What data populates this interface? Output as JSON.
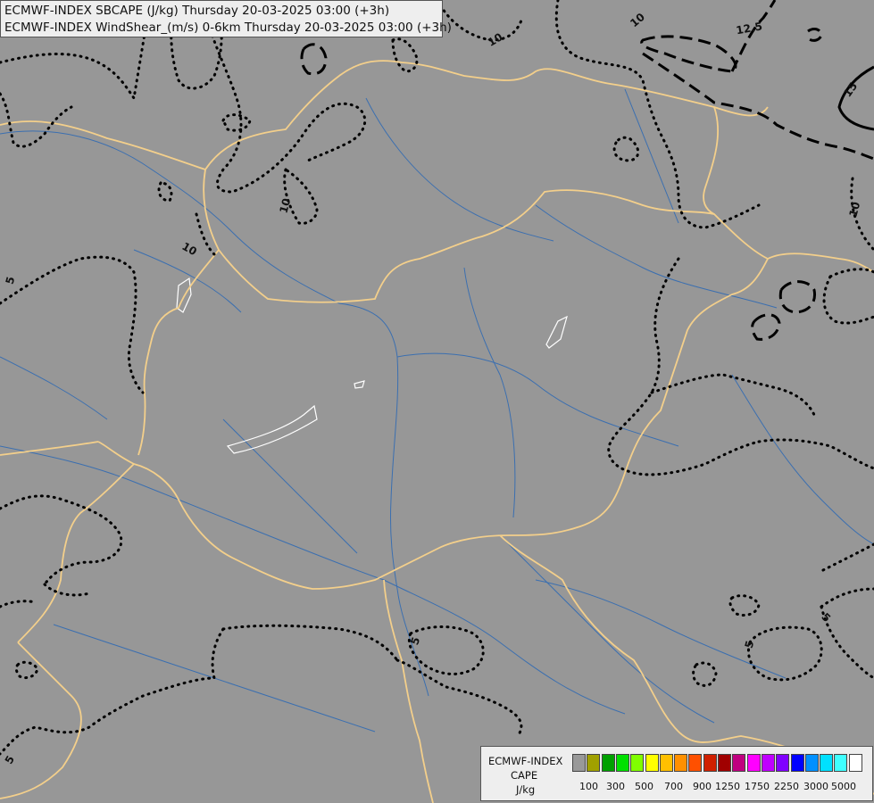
{
  "header": {
    "title_line1": "ECMWF-INDEX SBCAPE (J/kg) Thursday 20-03-2025 03:00 (+3h)",
    "title_line2": "ECMWF-INDEX WindShear_(m/s) 0-6km Thursday 20-03-2025 03:00 (+3h)"
  },
  "legend": {
    "model": "ECMWF-INDEX",
    "variable": "CAPE",
    "unit": "J/kg",
    "colors": [
      "#999999",
      "#a0a000",
      "#00a000",
      "#00e000",
      "#80ff00",
      "#ffff00",
      "#ffc000",
      "#ff9000",
      "#ff5000",
      "#d02000",
      "#a00000",
      "#c00080",
      "#ff00ff",
      "#c000ff",
      "#8000ff",
      "#0000ff",
      "#0090ff",
      "#00e0ff",
      "#40ffff",
      "#ffffff"
    ],
    "ticks": [
      "100",
      "300",
      "500",
      "700",
      "900",
      "1250",
      "1750",
      "2250",
      "3000",
      "5000"
    ]
  },
  "contour_labels": [
    "10",
    "10",
    "10",
    "10",
    "10",
    "12.5",
    "15",
    "5",
    "5",
    "5",
    "5",
    "5",
    "5"
  ]
}
